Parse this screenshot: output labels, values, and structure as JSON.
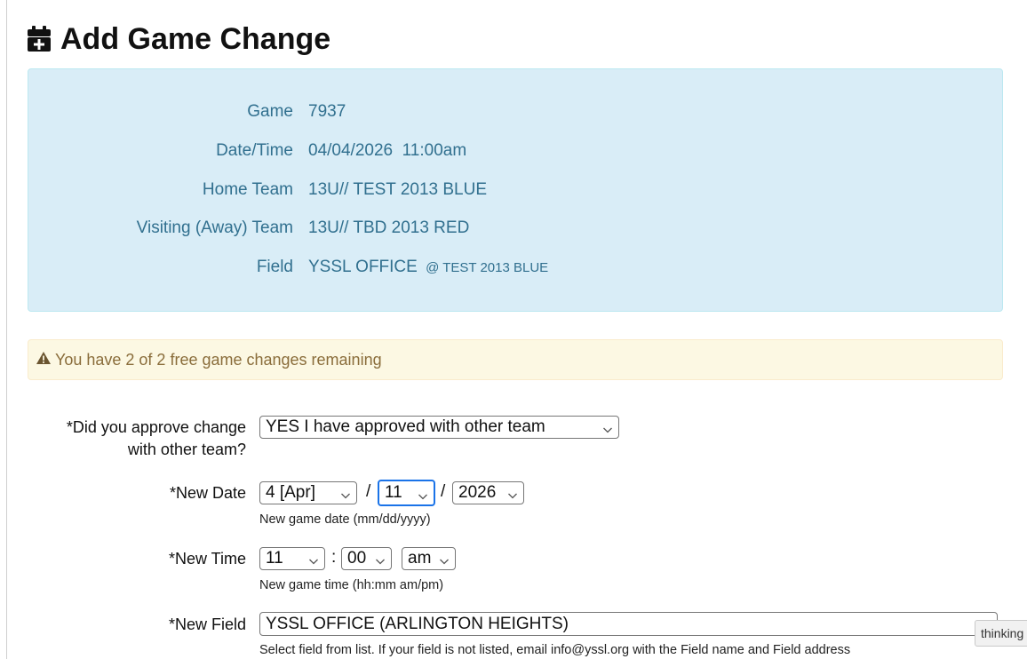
{
  "page": {
    "title": "Add Game Change"
  },
  "game_info": {
    "game_label": "Game",
    "game_value": "7937",
    "datetime_label": "Date/Time",
    "datetime_value": "04/04/2026  11:00am",
    "home_label": "Home Team",
    "home_value": "13U// TEST 2013 BLUE",
    "visiting_label": "Visiting (Away) Team",
    "visiting_value": "13U// TBD 2013 RED",
    "field_label": "Field",
    "field_value": "YSSL OFFICE",
    "field_sub": "@ TEST 2013 BLUE"
  },
  "alert": {
    "text": "You have 2 of 2 free game changes remaining"
  },
  "form": {
    "approve_label_line1": "*Did you approve change",
    "approve_label_line2": "with other team?",
    "approve_value": "YES I have approved with other team",
    "date_label": "*New Date",
    "date_month": "4 [Apr]",
    "date_sep1": "/",
    "date_day": "11",
    "date_sep2": "/",
    "date_year": "2026",
    "date_help": "New game date (mm/dd/yyyy)",
    "time_label": "*New Time",
    "time_hour": "11",
    "time_sep": ":",
    "time_minute": "00",
    "time_ampm": "am",
    "time_help": "New game time (hh:mm am/pm)",
    "field_label": "*New Field",
    "field_value": "YSSL OFFICE (ARLINGTON HEIGHTS)",
    "field_help": "Select field from list. If your field is not listed, email info@yssl.org with the Field name and Field address"
  },
  "tooltip": {
    "text": "thinking"
  },
  "colors": {
    "info_bg": "#d9edf7",
    "info_text": "#31708f",
    "alert_bg": "#fcf8e3",
    "alert_text": "#8a6d3b",
    "focus": "#1a73e8"
  },
  "icons": {
    "title": "calendar-plus-icon",
    "alert": "warning-triangle-icon",
    "select": "chevron-down-icon"
  }
}
